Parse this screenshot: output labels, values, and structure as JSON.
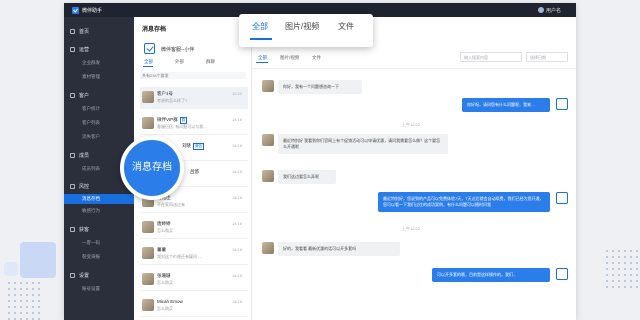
{
  "topbar": {
    "app_name": "微伴助手",
    "user_name": "用户名"
  },
  "sidebar": {
    "groups": [
      {
        "label": "首页",
        "subs": []
      },
      {
        "label": "运营",
        "subs": [
          "企业群发",
          "素材管理"
        ]
      },
      {
        "label": "客户",
        "subs": [
          "客户统计",
          "客户列表",
          "流失客户"
        ]
      },
      {
        "label": "成员",
        "subs": [
          "成员列表"
        ]
      },
      {
        "label": "风控",
        "subs": [
          "消息存档",
          "敏感行为"
        ]
      },
      {
        "label": "获客",
        "subs": [
          "一客一码",
          "裂变海报"
        ]
      },
      {
        "label": "设置",
        "subs": [
          "账号设置"
        ]
      }
    ]
  },
  "conversation": {
    "title": "消息存档",
    "staff_name": "微伴客服--小伴",
    "tabs": [
      "全部",
      "外部",
      "群聊"
    ],
    "count_text": "共有234个群发",
    "items": [
      {
        "name": "客户1号",
        "preview": "考虑的怎么样了?",
        "time": "12:22",
        "badge": ""
      },
      {
        "name": "微伴VIP群",
        "preview": "客服伍伍: 有问题可以与我…",
        "time": "14:16",
        "badge": "群"
      },
      {
        "name": "刘晓",
        "preview": "",
        "time": "14:16",
        "badge": "微信"
      },
      {
        "name": "吕悠",
        "preview": "",
        "time": "14:16",
        "badge": ""
      },
      {
        "name": "明铭佳",
        "preview": "不在家再送过来",
        "time": "14:16",
        "badge": ""
      },
      {
        "name": "唐婷婷",
        "preview": "怎么购买",
        "time": "14:16",
        "badge": ""
      },
      {
        "name": "薯薯",
        "preview": "我对这个价格还有疑问 …",
        "time": "14:16",
        "badge": ""
      },
      {
        "name": "张珊珊",
        "preview": "怎么购买",
        "time": "14:16",
        "badge": ""
      },
      {
        "name": "Micah Emow",
        "preview": "怎么购买",
        "time": "14:16",
        "badge": ""
      }
    ]
  },
  "chat": {
    "tabs": [
      "全部",
      "图片/视频",
      "文件"
    ],
    "search_placeholder": "输入搜索内容",
    "date_placeholder": "选择日期",
    "messages": [
      {
        "dir": "in",
        "text": "你好，我有一个问题想咨询一下"
      },
      {
        "dir": "out",
        "text": "你好呀，请问您有什么问题呢，我来…"
      },
      {
        "dir": "time",
        "text": "上午12:22"
      },
      {
        "dir": "in",
        "text": "最近特别好 我看到你们官网上有个促销活动可以申请优惠，请问我需要怎么做？这个要怎么开通呢"
      },
      {
        "dir": "in",
        "text": "我们这边要怎么弄呢"
      },
      {
        "dir": "out",
        "text": "最近特别好，您说到的产品可以免费体验7天，7天过后就会自动续费，我们已经为您开通，您可以看一下我们过往的成功案例，有什么问题可以随时问我"
      },
      {
        "dir": "time",
        "text": "上午12:22"
      },
      {
        "dir": "in",
        "text": "好的，我看看 最新优惠的话可以开多套吗"
      },
      {
        "dir": "out",
        "text": "可以开多套的哦，目前是这样操作的，我们..."
      }
    ]
  },
  "popup": {
    "tabs": [
      "全部",
      "图片/视频",
      "文件"
    ]
  },
  "zoom_label": "消息存档"
}
